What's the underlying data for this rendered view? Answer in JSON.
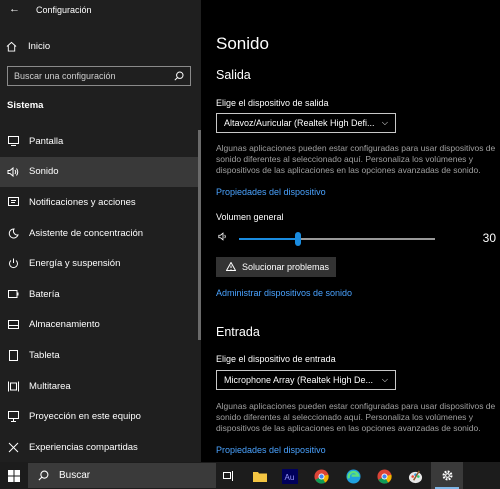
{
  "window": {
    "title": "Configuración"
  },
  "sidebar": {
    "home_label": "Inicio",
    "search_placeholder": "Buscar una configuración",
    "section_label": "Sistema",
    "items": [
      {
        "label": "Pantalla",
        "icon": "display-icon"
      },
      {
        "label": "Sonido",
        "icon": "speaker-icon",
        "active": true
      },
      {
        "label": "Notificaciones y acciones",
        "icon": "notification-icon"
      },
      {
        "label": "Asistente de concentración",
        "icon": "moon-icon"
      },
      {
        "label": "Energía y suspensión",
        "icon": "power-icon"
      },
      {
        "label": "Batería",
        "icon": "battery-icon"
      },
      {
        "label": "Almacenamiento",
        "icon": "storage-icon"
      },
      {
        "label": "Tableta",
        "icon": "tablet-icon"
      },
      {
        "label": "Multitarea",
        "icon": "multitask-icon"
      },
      {
        "label": "Proyección en este equipo",
        "icon": "projection-icon"
      },
      {
        "label": "Experiencias compartidas",
        "icon": "shared-icon"
      }
    ]
  },
  "main": {
    "title": "Sonido",
    "output": {
      "heading": "Salida",
      "device_label": "Elige el dispositivo de salida",
      "device_value": "Altavoz/Auricular (Realtek High Defi...",
      "description": "Algunas aplicaciones pueden estar configuradas para usar dispositivos de sonido diferentes al seleccionado aquí. Personaliza los volúmenes y dispositivos de las aplicaciones en las opciones avanzadas de sonido.",
      "properties_link": "Propiedades del dispositivo",
      "volume_label": "Volumen general",
      "volume_value": "30",
      "volume_level": 0.3,
      "troubleshoot_label": "Solucionar problemas",
      "manage_link": "Administrar dispositivos de sonido"
    },
    "input": {
      "heading": "Entrada",
      "device_label": "Elige el dispositivo de entrada",
      "device_value": "Microphone Array (Realtek High De...",
      "description": "Algunas aplicaciones pueden estar configuradas para usar dispositivos de sonido diferentes al seleccionado aquí. Personaliza los volúmenes y dispositivos de las aplicaciones en las opciones avanzadas de sonido.",
      "properties_link": "Propiedades del dispositivo"
    }
  },
  "taskbar": {
    "search_label": "Buscar",
    "apps": [
      "task-view-icon",
      "file-explorer-icon",
      "audition-icon",
      "chrome-icon",
      "edge-icon",
      "chrome-icon",
      "paint-icon",
      "settings-icon"
    ],
    "accent": "#1a8ce0",
    "link_color": "#4aa3ff"
  }
}
